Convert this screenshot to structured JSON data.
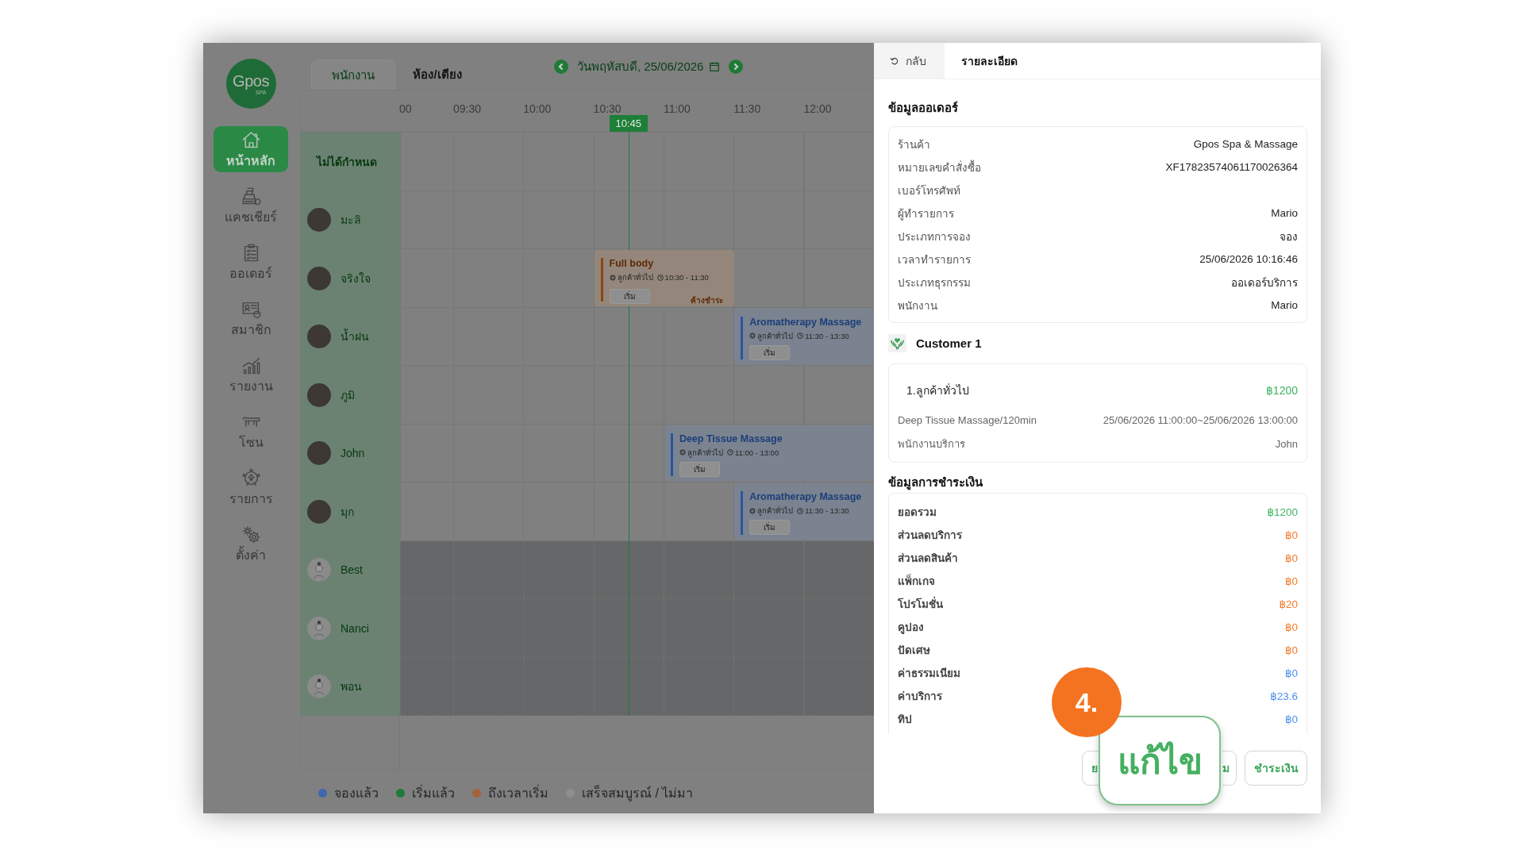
{
  "sidebar": {
    "logo": {
      "wordmark": "Gpos",
      "tagline": "SPA"
    },
    "items": [
      {
        "label": "หน้าหลัก",
        "selected": true
      },
      {
        "label": "แคชเชียร์",
        "selected": false
      },
      {
        "label": "ออเดอร์",
        "selected": false
      },
      {
        "label": "สมาชิก",
        "selected": false
      },
      {
        "label": "รายงาน",
        "selected": false
      },
      {
        "label": "โซน",
        "selected": false
      },
      {
        "label": "รายการ",
        "selected": false
      },
      {
        "label": "ตั้งค่า",
        "selected": false
      }
    ]
  },
  "view_tabs": [
    {
      "label": "พนักงาน",
      "selected": true
    },
    {
      "label": "ห้อง/เตียง",
      "selected": false
    }
  ],
  "date_nav": {
    "date": "วันพฤหัสบดี, 25/06/2026"
  },
  "timeline": {
    "times": [
      "00",
      "09:30",
      "10:00",
      "10:30",
      "11:00",
      "11:30",
      "12:00"
    ],
    "now": "10:45",
    "rows": [
      {
        "name": "ไม่ได้กำหนด",
        "kind": "unassigned",
        "available": true,
        "bookings": []
      },
      {
        "name": "มะลิ",
        "kind": "photo",
        "available": true,
        "bookings": []
      },
      {
        "name": "จริงใจ",
        "kind": "photo",
        "available": true,
        "bookings": [
          {
            "title": "Full body",
            "customer": "ลูกค้าทั่วไป",
            "time": "10:30 - 11:30",
            "due": true,
            "button": "เริ่ม",
            "note": "ค้างชำระ"
          }
        ]
      },
      {
        "name": "น้ำฝน",
        "kind": "photo",
        "available": true,
        "bookings": [
          {
            "title": "Aromatherapy Massage",
            "customer": "ลูกค้าทั่วไป",
            "time": "11:30 - 13:30",
            "due": false,
            "button": "เริ่ม"
          }
        ]
      },
      {
        "name": "ภูมิ",
        "kind": "photo",
        "available": true,
        "bookings": []
      },
      {
        "name": "John",
        "kind": "photo",
        "available": true,
        "bookings": [
          {
            "title": "Deep Tissue Massage",
            "customer": "ลูกค้าทั่วไป",
            "time": "11:00 - 13:00",
            "due": false,
            "button": "เริ่ม"
          }
        ]
      },
      {
        "name": "มุก",
        "kind": "photo",
        "available": true,
        "bookings": [
          {
            "title": "Aromatherapy Massage",
            "customer": "ลูกค้าทั่วไป",
            "time": "11:30 - 13:30",
            "due": false,
            "button": "เริ่ม"
          }
        ]
      },
      {
        "name": "Best",
        "kind": "illustration",
        "available": false,
        "bookings": []
      },
      {
        "name": "Nanci",
        "kind": "illustration",
        "available": false,
        "bookings": []
      },
      {
        "name": "พอน",
        "kind": "illustration",
        "available": false,
        "bookings": []
      }
    ]
  },
  "legend": [
    {
      "label": "จองแล้ว",
      "color": "#3e67ad"
    },
    {
      "label": "เริ่มแล้ว",
      "color": "#1f7a3a"
    },
    {
      "label": "ถึงเวลาเริ่ม",
      "color": "#a5623a"
    },
    {
      "label": "เสร็จสมบูรณ์ / ไม่มา",
      "color": "#8e8e8e"
    }
  ],
  "detail": {
    "back": "กลับ",
    "title": "รายละเอียด"
  },
  "order_info": {
    "title": "ข้อมูลออเดอร์",
    "rows": [
      {
        "label": "ร้านค้า",
        "value": "Gpos Spa & Massage"
      },
      {
        "label": "หมายเลขคำสั่งซื้อ",
        "value": "XF17823574061170026364"
      },
      {
        "label": "เบอร์โทรศัพท์"
      },
      {
        "label": "ผู้ทำรายการ",
        "value": "Mario"
      },
      {
        "label": "ประเภทการจอง",
        "value": "จอง"
      },
      {
        "label": "เวลาทำรายการ",
        "value": "25/06/2026 10:16:46"
      },
      {
        "label": "ประเภทธุรกรรม",
        "value": "ออเดอร์บริการ"
      },
      {
        "label": "พนักงาน",
        "value": "Mario"
      }
    ]
  },
  "customers": [
    {
      "title": "Customer 1",
      "items": [
        {
          "name": "1.ลูกค้าทั่วไป",
          "price": "฿1200",
          "service": "Deep Tissue Massage/120min",
          "period": "25/06/2026 11:00:00~25/06/2026 13:00:00",
          "staff_label": "พนักงานบริการ",
          "staff": "John"
        }
      ]
    }
  ],
  "payment": {
    "title": "ข้อมูลการชำระเงิน",
    "rows": [
      {
        "label": "ยอดรวม",
        "value": "฿1200",
        "kind": "total"
      },
      {
        "label": "ส่วนลดบริการ",
        "value": "฿0",
        "kind": "deduction"
      },
      {
        "label": "ส่วนลดสินค้า",
        "value": "฿0",
        "kind": "deduction"
      },
      {
        "label": "แพ็กเกจ",
        "value": "฿0",
        "kind": "deduction"
      },
      {
        "label": "โปรโมชั่น",
        "value": "฿20",
        "kind": "deduction"
      },
      {
        "label": "คูปอง",
        "value": "฿0",
        "kind": "deduction"
      },
      {
        "label": "ปัดเศษ",
        "value": "฿0",
        "kind": "deduction"
      },
      {
        "label": "ค่าธรรมเนียม",
        "value": "฿0",
        "kind": "charge"
      },
      {
        "label": "ค่าบริการ",
        "value": "฿23.6",
        "kind": "charge"
      },
      {
        "label": "ทิป",
        "value": "฿0",
        "kind": "charge"
      }
    ]
  },
  "actions": [
    {
      "label": "ย",
      "kind": "covered_left"
    },
    {
      "label": "ม",
      "kind": "covered_right"
    },
    {
      "label": "ชำระเงิน",
      "kind": "full"
    }
  ],
  "callout": {
    "number": "4.",
    "label": "แก้ไข"
  }
}
